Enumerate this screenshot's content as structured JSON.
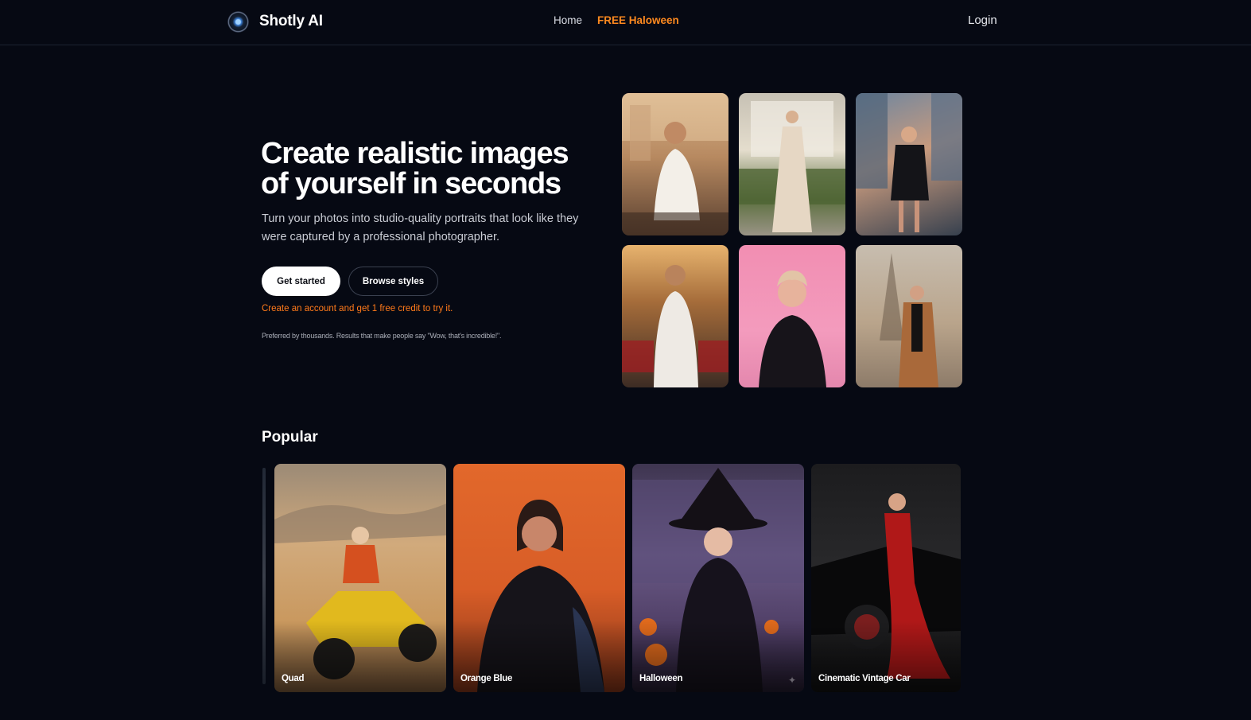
{
  "header": {
    "brand": "Shotly AI",
    "nav": {
      "home": "Home",
      "halloween": "FREE Haloween"
    },
    "login": "Login"
  },
  "hero": {
    "title_line1": "Create realistic images",
    "title_line2": "of yourself in seconds",
    "subtitle": "Turn your photos into studio-quality portraits that look like they were captured by a professional photographer.",
    "primary_button": "Get started",
    "secondary_button": "Browse styles",
    "promo": "Create an account and get 1 free credit to try it.",
    "social_proof": "Preferred by thousands. Results that make people say \"Wow, that's incredible!\"."
  },
  "popular": {
    "title": "Popular",
    "items": [
      {
        "label": "Quad"
      },
      {
        "label": "Orange Blue"
      },
      {
        "label": "Halloween"
      },
      {
        "label": "Cinematic Vintage Car"
      }
    ]
  },
  "colors": {
    "background": "#060913",
    "accent_orange": "#ff8a1f",
    "button_white": "#ffffff"
  }
}
